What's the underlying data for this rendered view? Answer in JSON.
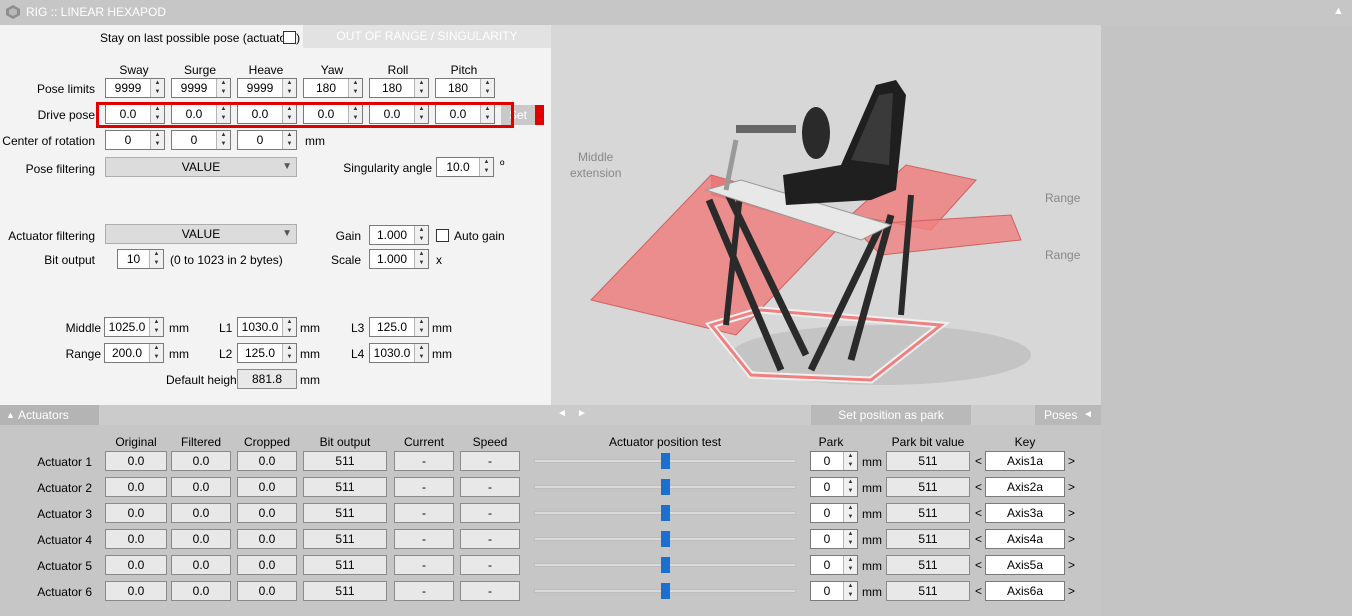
{
  "window": {
    "title": "RIG :: LINEAR HEXAPOD"
  },
  "top": {
    "stay_label": "Stay on last possible pose (actuators)",
    "status": "OUT OF RANGE / SINGULARITY"
  },
  "columns": [
    "Sway",
    "Surge",
    "Heave",
    "Yaw",
    "Roll",
    "Pitch"
  ],
  "pose_limits": {
    "label": "Pose limits",
    "values": [
      "9999",
      "9999",
      "9999",
      "180",
      "180",
      "180"
    ]
  },
  "drive_pose": {
    "label": "Drive pose",
    "values": [
      "0.0",
      "0.0",
      "0.0",
      "0.0",
      "0.0",
      "0.0"
    ],
    "set_label": "Set"
  },
  "center": {
    "label": "Center of rotation",
    "values": [
      "0",
      "0",
      "0"
    ],
    "unit": "mm"
  },
  "pose_filtering": {
    "label": "Pose filtering",
    "value": "VALUE"
  },
  "singularity": {
    "label": "Singularity angle",
    "value": "10.0",
    "unit": "º"
  },
  "actuator_filtering": {
    "label": "Actuator filtering",
    "value": "VALUE"
  },
  "gain": {
    "label": "Gain",
    "value": "1.000",
    "auto_label": "Auto gain"
  },
  "bit_output": {
    "label": "Bit output",
    "value": "10",
    "note": "(0 to 1023 in 2 bytes)"
  },
  "scale": {
    "label": "Scale",
    "value": "1.000",
    "unit": "x"
  },
  "geometry": {
    "middle_label": "Middle",
    "middle": "1025.0",
    "range_label": "Range",
    "range": "200.0",
    "l1_label": "L1",
    "l1": "1030.0",
    "l2_label": "L2",
    "l2": "125.0",
    "l3_label": "L3",
    "l3": "125.0",
    "l4_label": "L4",
    "l4": "1030.0",
    "unit": "mm",
    "default_height_label": "Default height",
    "default_height": "881.8"
  },
  "diagram": {
    "middle_extension": "Middle\nextension",
    "range1": "Range",
    "range2": "Range"
  },
  "tabs": {
    "actuators": "Actuators",
    "set_park": "Set position as park",
    "poses": "Poses"
  },
  "actuators": {
    "headers": {
      "original": "Original",
      "filtered": "Filtered",
      "cropped": "Cropped",
      "bit_output": "Bit output",
      "current": "Current",
      "speed": "Speed",
      "test": "Actuator position test",
      "park": "Park",
      "park_bit": "Park bit value",
      "key": "Key"
    },
    "park_unit": "mm",
    "rows": [
      {
        "name": "Actuator 1",
        "original": "0.0",
        "filtered": "0.0",
        "cropped": "0.0",
        "bit": "511",
        "current": "-",
        "speed": "-",
        "park": "0",
        "park_bit": "511",
        "key": "Axis1a"
      },
      {
        "name": "Actuator 2",
        "original": "0.0",
        "filtered": "0.0",
        "cropped": "0.0",
        "bit": "511",
        "current": "-",
        "speed": "-",
        "park": "0",
        "park_bit": "511",
        "key": "Axis2a"
      },
      {
        "name": "Actuator 3",
        "original": "0.0",
        "filtered": "0.0",
        "cropped": "0.0",
        "bit": "511",
        "current": "-",
        "speed": "-",
        "park": "0",
        "park_bit": "511",
        "key": "Axis3a"
      },
      {
        "name": "Actuator 4",
        "original": "0.0",
        "filtered": "0.0",
        "cropped": "0.0",
        "bit": "511",
        "current": "-",
        "speed": "-",
        "park": "0",
        "park_bit": "511",
        "key": "Axis4a"
      },
      {
        "name": "Actuator 5",
        "original": "0.0",
        "filtered": "0.0",
        "cropped": "0.0",
        "bit": "511",
        "current": "-",
        "speed": "-",
        "park": "0",
        "park_bit": "511",
        "key": "Axis5a"
      },
      {
        "name": "Actuator 6",
        "original": "0.0",
        "filtered": "0.0",
        "cropped": "0.0",
        "bit": "511",
        "current": "-",
        "speed": "-",
        "park": "0",
        "park_bit": "511",
        "key": "Axis6a"
      }
    ]
  },
  "colors": {
    "highlight": "#e00000",
    "slider_thumb": "#1a6fd1",
    "panel": "#f3f3f3",
    "plane": "#f08080"
  }
}
